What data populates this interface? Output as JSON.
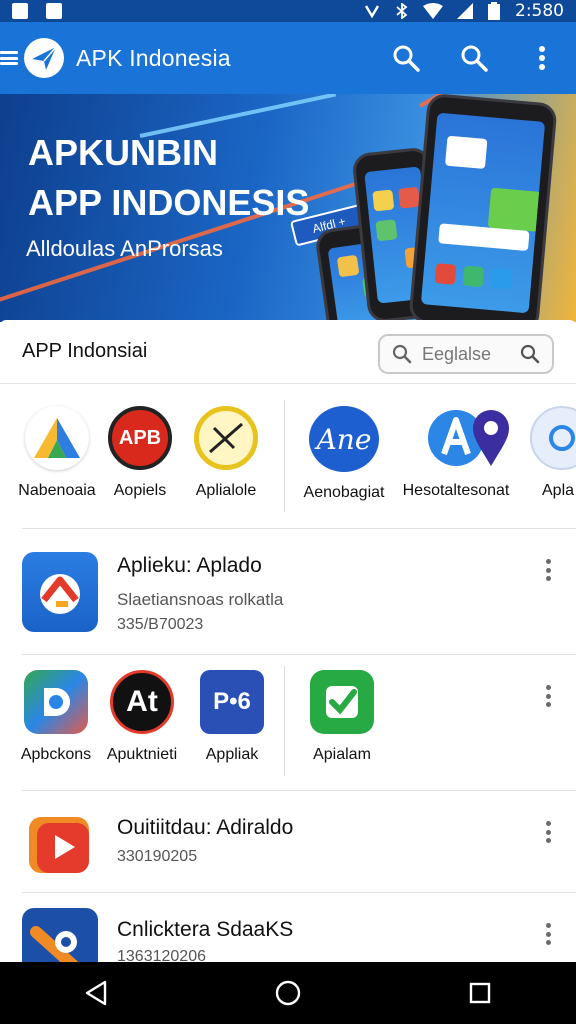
{
  "status_bar": {
    "time": "2:580"
  },
  "app_bar": {
    "title": "APK Indonesia",
    "icons": [
      "menu-icon",
      "app-logo",
      "search-icon",
      "search-icon",
      "more-vert-icon"
    ]
  },
  "banner": {
    "title_line1": "APKUNBIN",
    "title_line2": "APP INDONESIS",
    "subtitle": "Alldoulas AnProrsas",
    "badge": "Alfdl +"
  },
  "section": {
    "title": "APP Indonsiai",
    "search_placeholder": "Eeglalse"
  },
  "featured_apps": [
    {
      "label": "Nabenoaia",
      "icon": "triangle-logo-icon"
    },
    {
      "label": "Aopiels",
      "icon": "apb-badge-icon"
    },
    {
      "label": "Aplialole",
      "icon": "no-pen-icon"
    },
    {
      "label": "Aenobagiat",
      "icon": "script-a-icon"
    },
    {
      "label": "Hesotaltesonat",
      "icon": "letter-a-icon"
    },
    {
      "label": "Apla",
      "icon": "location-pin-icon"
    }
  ],
  "list_items": [
    {
      "title": "Aplieku: Aplado",
      "subtitle": "Slaetiansnoas rolkatla",
      "number": "335/B70023",
      "icon": "chart-arrow-icon"
    },
    {
      "title": "Ouitiitdau: Adiraldo",
      "number": "330190205",
      "icon": "play-icon"
    },
    {
      "title": "Cnlicktera SdaaKS",
      "number": "1363120206",
      "icon": "camera-tool-icon"
    }
  ],
  "second_row_apps": [
    {
      "label": "Apbckons",
      "icon": "d-logo-icon"
    },
    {
      "label": "Apuktnieti",
      "icon": "at-logo-icon"
    },
    {
      "label": "Appliak",
      "icon": "p-chat-icon"
    },
    {
      "label": "Apialam",
      "icon": "check-icon"
    }
  ],
  "nav_bar": {
    "icons": [
      "back-icon",
      "home-icon",
      "recents-icon"
    ]
  },
  "colors": {
    "primary": "#1a73d6",
    "status": "#0f4a9a"
  }
}
